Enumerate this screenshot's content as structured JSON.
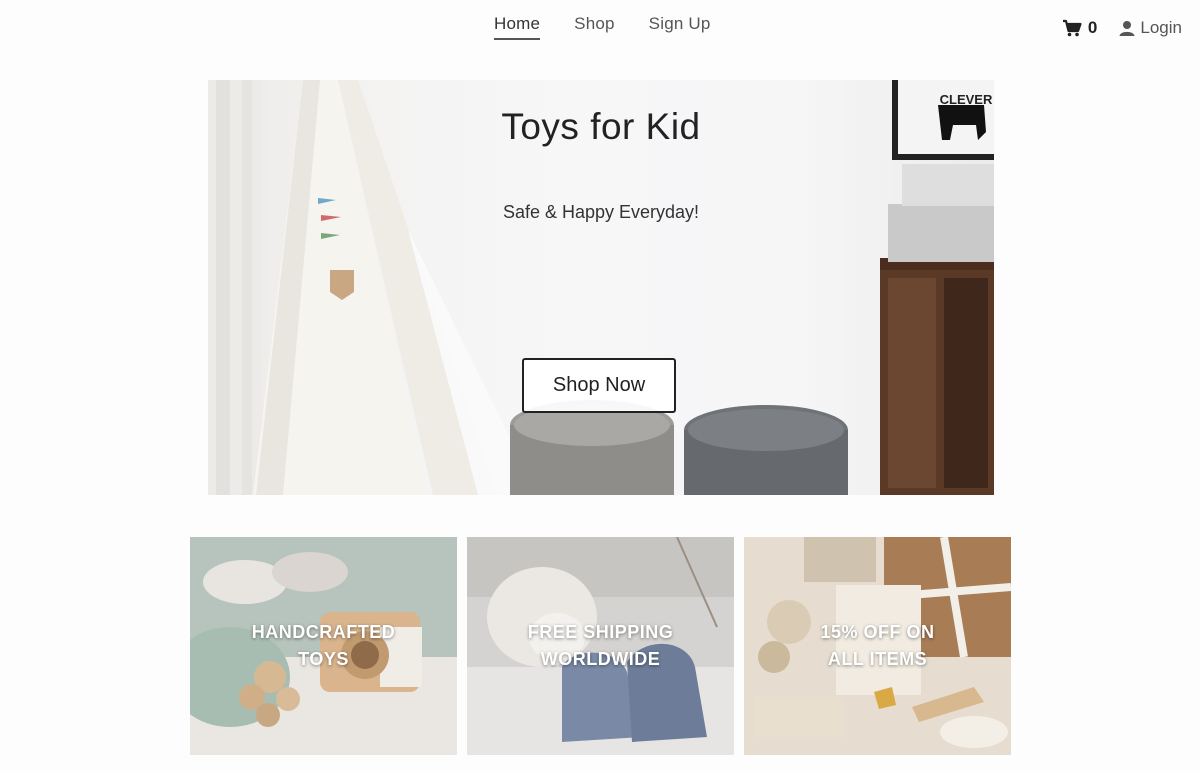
{
  "nav": {
    "links": [
      {
        "label": "Home",
        "active": true
      },
      {
        "label": "Shop",
        "active": false
      },
      {
        "label": "Sign Up",
        "active": false
      }
    ],
    "cart_count": "0",
    "cart_icon": "shopping-cart-icon",
    "login_label": "Login",
    "login_icon": "user-icon"
  },
  "hero": {
    "title": "Toys for Kid",
    "subtitle": "Safe & Happy Everyday!",
    "button_label": "Shop Now",
    "poster_text": "CLEVER"
  },
  "tiles": [
    {
      "line1": "HANDCRAFTED",
      "line2": "TOYS"
    },
    {
      "line1": "FREE SHIPPING",
      "line2": "WORLDWIDE"
    },
    {
      "line1": "15% OFF ON",
      "line2": "ALL ITEMS"
    }
  ]
}
